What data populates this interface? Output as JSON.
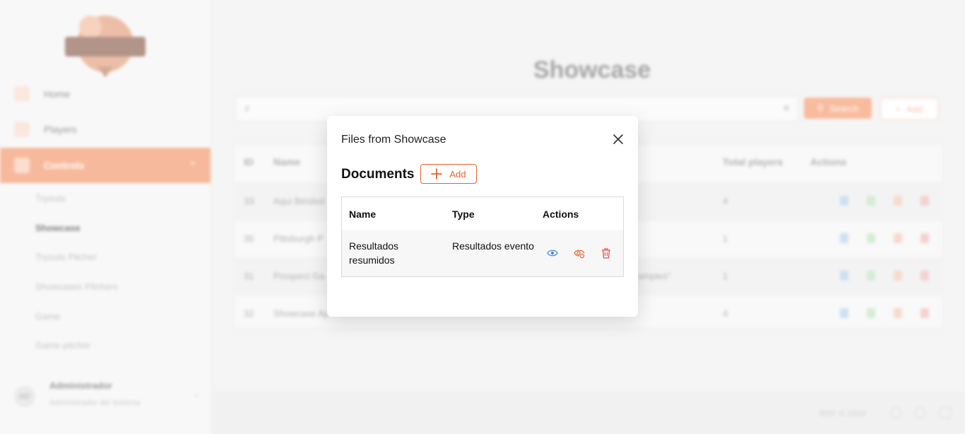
{
  "sidebar": {
    "items": [
      {
        "label": "Home"
      },
      {
        "label": "Players"
      },
      {
        "label": "Controls"
      }
    ],
    "subitems": [
      {
        "label": "Tryouts"
      },
      {
        "label": "Showcase"
      },
      {
        "label": "Tryouts Pitcher"
      },
      {
        "label": "Showcases Pitchers"
      },
      {
        "label": "Game"
      },
      {
        "label": "Game pitcher"
      }
    ],
    "user": {
      "initials": "AD",
      "name": "Administrador",
      "role": "Administrador del Sistema"
    }
  },
  "page": {
    "title": "Showcase",
    "search_placeholder": "#",
    "search_label": "Search",
    "add_label": "Add"
  },
  "table": {
    "headers": {
      "id": "ID",
      "name": "Name",
      "total": "Total players",
      "actions": "Actions"
    },
    "rows": [
      {
        "id": "33",
        "name": "Aqui Beisbol",
        "extra": "",
        "total": "4"
      },
      {
        "id": "35",
        "name": "Pittsburgh P",
        "extra": "",
        "total": "1"
      },
      {
        "id": "31",
        "name": "Prospect Ga",
        "extra": "amples\"",
        "total": "1"
      },
      {
        "id": "32",
        "name": "Showcase Ap",
        "extra": "",
        "total": "4"
      }
    ]
  },
  "footer": {
    "copyright": "RKF © 2024"
  },
  "modal": {
    "title": "Files from Showcase",
    "section": "Documents",
    "add_label": "Add",
    "headers": {
      "name": "Name",
      "type": "Type",
      "actions": "Actions"
    },
    "rows": [
      {
        "name": "Resultados resumidos",
        "type": "Resultados evento"
      }
    ]
  },
  "colors": {
    "accent": "#e8622a",
    "view_icon": "#4a90d9",
    "delete_icon": "#e05252"
  }
}
